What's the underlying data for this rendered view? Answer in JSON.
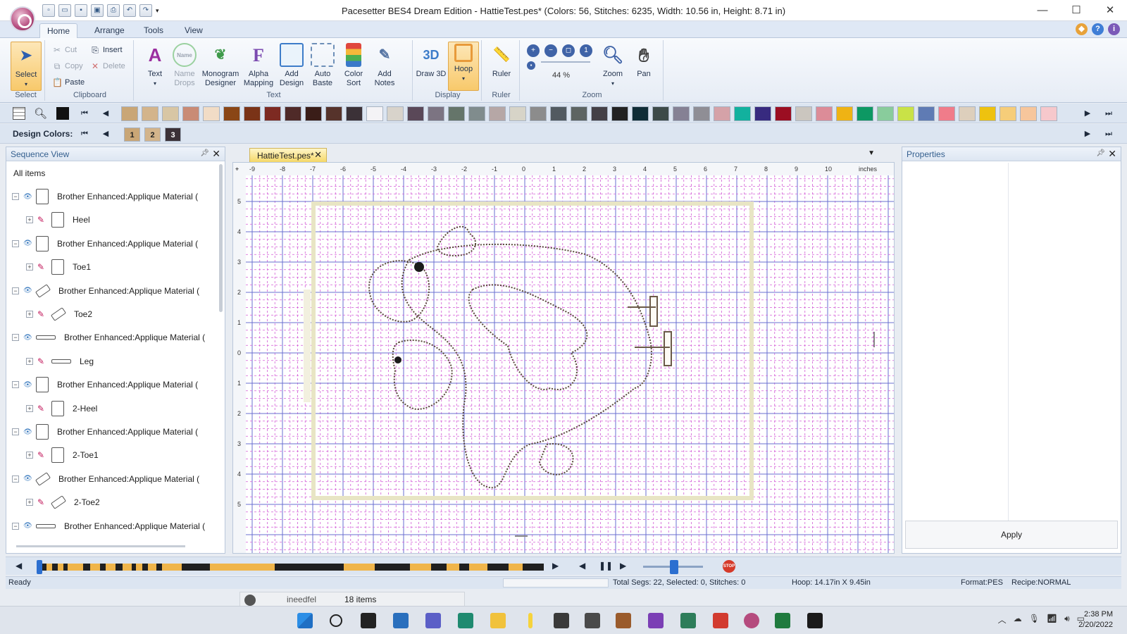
{
  "window": {
    "title": "Pacesetter BES4 Dream Edition - HattieTest.pes* (Colors: 56, Stitches: 6235, Width: 10.56 in, Height: 8.71 in)"
  },
  "ribbon_tabs": [
    "Home",
    "Arrange",
    "Tools",
    "View"
  ],
  "ribbon": {
    "select": {
      "label": "Select",
      "group": "Select"
    },
    "clipboard": {
      "cut": "Cut",
      "copy": "Copy",
      "paste": "Paste",
      "insert": "Insert",
      "delete": "Delete",
      "group": "Clipboard"
    },
    "text_group": {
      "buttons": [
        "Text",
        "Name Drops",
        "Monogram Designer",
        "Alpha Mapping",
        "Add Design",
        "Auto Baste",
        "Color Sort",
        "Add Notes"
      ],
      "group": "Text"
    },
    "display": {
      "draw3d": "Draw 3D",
      "hoop": "Hoop",
      "group": "Display"
    },
    "ruler": {
      "label": "Ruler",
      "group": "Ruler"
    },
    "zoom": {
      "percent": "44 %",
      "zoom": "Zoom",
      "pan": "Pan",
      "group": "Zoom"
    }
  },
  "palette_colors": [
    "#c9a676",
    "#d3b48b",
    "#d8c6a4",
    "#c98b75",
    "#f1dcc6",
    "#8a4616",
    "#7a3317",
    "#7d2a22",
    "#4f2a28",
    "#3a1d18",
    "#56332b",
    "#3b3137",
    "#f4f3f6",
    "#d8d3cb",
    "#5a4858",
    "#7c7482",
    "#65756a",
    "#808c8d",
    "#b6a7a6",
    "#d7d4c8",
    "#8c8c8c",
    "#525a60",
    "#5d6462",
    "#444046",
    "#222222",
    "#0f2c36",
    "#3d4a48",
    "#858194",
    "#8f8e95",
    "#d5a2a8",
    "#12b19e",
    "#372a7f",
    "#9b0e22",
    "#cbc6bf",
    "#dc8c98",
    "#efb314",
    "#0d9863",
    "#89cc9c",
    "#c9e247",
    "#5f7bb4",
    "#f07c8a",
    "#ddcfbc",
    "#eec20f",
    "#f6cd79",
    "#f7c69c",
    "#f6c8cc"
  ],
  "design_colors": {
    "label": "Design Colors:",
    "chips": [
      {
        "num": "1",
        "color": "#c9a676"
      },
      {
        "num": "2",
        "color": "#d3b48b"
      },
      {
        "num": "3",
        "color": "#3b3137"
      }
    ]
  },
  "sequence_view": {
    "title": "Sequence View",
    "root": "All items",
    "rows": [
      {
        "label": "Brother Enhanced:Applique Material (",
        "kind": "group",
        "shape": "tall"
      },
      {
        "label": "Heel",
        "kind": "child",
        "shape": "tall"
      },
      {
        "label": "Brother Enhanced:Applique Material (",
        "kind": "group",
        "shape": "tall"
      },
      {
        "label": "Toe1",
        "kind": "child",
        "shape": "tall"
      },
      {
        "label": "Brother Enhanced:Applique Material (",
        "kind": "group",
        "shape": "diag"
      },
      {
        "label": "Toe2",
        "kind": "child",
        "shape": "diag"
      },
      {
        "label": "Brother Enhanced:Applique Material (",
        "kind": "group",
        "shape": "wide"
      },
      {
        "label": "Leg",
        "kind": "child",
        "shape": "wide"
      },
      {
        "label": "Brother Enhanced:Applique Material (",
        "kind": "group",
        "shape": "tall"
      },
      {
        "label": "2-Heel",
        "kind": "child",
        "shape": "tall"
      },
      {
        "label": "Brother Enhanced:Applique Material (",
        "kind": "group",
        "shape": "tall"
      },
      {
        "label": "2-Toe1",
        "kind": "child",
        "shape": "tall"
      },
      {
        "label": "Brother Enhanced:Applique Material (",
        "kind": "group",
        "shape": "diag"
      },
      {
        "label": "2-Toe2",
        "kind": "child",
        "shape": "diag"
      },
      {
        "label": "Brother Enhanced:Applique Material (",
        "kind": "group",
        "shape": "wide"
      }
    ]
  },
  "document_tab": "HattieTest.pes*",
  "ruler": {
    "x_labels": [
      "-9",
      "-8",
      "-7",
      "-6",
      "-5",
      "-4",
      "-3",
      "-2",
      "-1",
      "0",
      "1",
      "2",
      "3",
      "4",
      "5",
      "6",
      "7",
      "8",
      "9",
      "10"
    ],
    "y_labels": [
      "5",
      "4",
      "3",
      "2",
      "1",
      "0",
      "1",
      "2",
      "3",
      "4",
      "5"
    ],
    "unit": "inches"
  },
  "properties": {
    "title": "Properties",
    "apply": "Apply"
  },
  "status": {
    "ready": "Ready",
    "totals": "Total Segs: 22, Selected: 0, Stitches: 0",
    "hoop": "Hoop: 14.17in X 9.45in",
    "format": "Format:PES",
    "recipe": "Recipe:NORMAL"
  },
  "explorer": {
    "items": "18 items",
    "name": "ineedfel"
  },
  "clock": {
    "time": "2:38 PM",
    "date": "2/20/2022"
  },
  "playback_stop": "STOP"
}
